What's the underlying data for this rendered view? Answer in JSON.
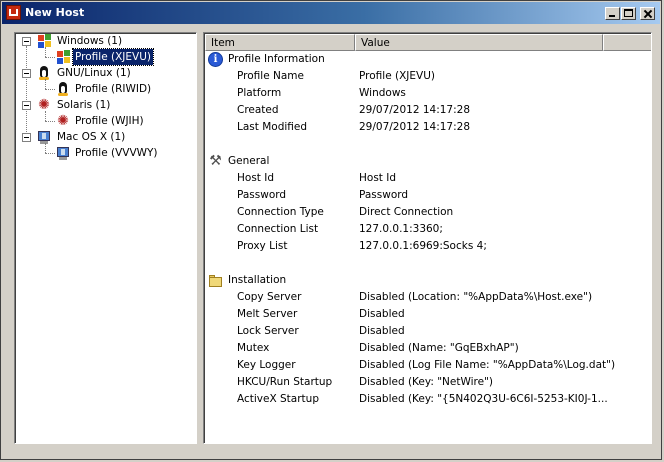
{
  "window": {
    "title": "New Host"
  },
  "tree": [
    {
      "label": "Windows (1)",
      "icon": "windows-icon",
      "child": {
        "label": "Profile (XJEVU)",
        "selected": true
      }
    },
    {
      "label": "GNU/Linux (1)",
      "icon": "tux-icon",
      "child": {
        "label": "Profile (RIWID)"
      }
    },
    {
      "label": "Solaris (1)",
      "icon": "solaris-icon",
      "child": {
        "label": "Profile (WJIH)"
      }
    },
    {
      "label": "Mac OS X (1)",
      "icon": "mac-icon",
      "child": {
        "label": "Profile (VVVWY)"
      }
    }
  ],
  "list": {
    "columns": [
      "Item",
      "Value"
    ],
    "groups": [
      {
        "name": "Profile Information",
        "icon": "info-icon",
        "items": [
          {
            "name": "Profile Name",
            "value": "Profile (XJEVU)"
          },
          {
            "name": "Platform",
            "value": "Windows"
          },
          {
            "name": "Created",
            "value": "29/07/2012 14:17:28"
          },
          {
            "name": "Last Modified",
            "value": "29/07/2012 14:17:28"
          }
        ]
      },
      {
        "name": "General",
        "icon": "tools-icon",
        "items": [
          {
            "name": "Host Id",
            "value": "Host Id"
          },
          {
            "name": "Password",
            "value": "Password"
          },
          {
            "name": "Connection Type",
            "value": "Direct Connection"
          },
          {
            "name": "Connection List",
            "value": "127.0.0.1:3360;"
          },
          {
            "name": "Proxy List",
            "value": "127.0.0.1:6969:Socks 4;"
          }
        ]
      },
      {
        "name": "Installation",
        "icon": "folder-icon",
        "items": [
          {
            "name": "Copy Server",
            "value": "Disabled (Location: \"%AppData%\\Host.exe\")"
          },
          {
            "name": "Melt Server",
            "value": "Disabled"
          },
          {
            "name": "Lock Server",
            "value": "Disabled"
          },
          {
            "name": "Mutex",
            "value": "Disabled (Name: \"GqEBxhAP\")"
          },
          {
            "name": "Key Logger",
            "value": "Disabled (Log File Name: \"%AppData%\\Log.dat\")"
          },
          {
            "name": "HKCU/Run Startup",
            "value": "Disabled (Key: \"NetWire\")"
          },
          {
            "name": "ActiveX Startup",
            "value": "Disabled (Key: \"{5N402Q3U-6C6I-5253-KI0J-1..."
          }
        ]
      }
    ]
  }
}
